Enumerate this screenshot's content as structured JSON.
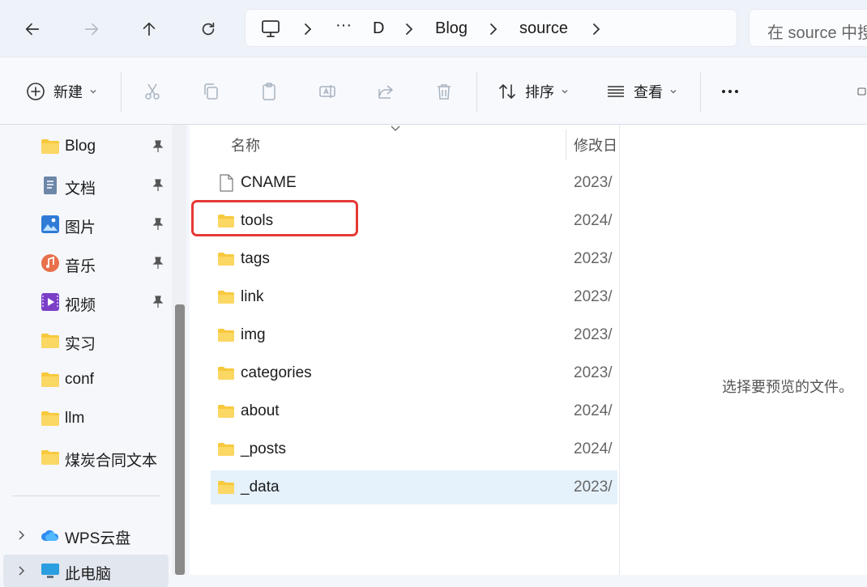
{
  "address_bar": {
    "path": [
      "D",
      "Blog",
      "source"
    ],
    "ellipsis": "···"
  },
  "search": {
    "placeholder": "在 source 中搜"
  },
  "commands": {
    "new": "新建",
    "sort": "排序",
    "view": "查看"
  },
  "nav": {
    "quick_access": [
      {
        "label": "Blog",
        "icon": "folder-icon",
        "pinned": true
      },
      {
        "label": "文档",
        "icon": "documents-icon",
        "pinned": true
      },
      {
        "label": "图片",
        "icon": "pictures-icon",
        "pinned": true
      },
      {
        "label": "音乐",
        "icon": "music-icon",
        "pinned": true
      },
      {
        "label": "视频",
        "icon": "videos-icon",
        "pinned": true
      },
      {
        "label": "实习",
        "icon": "folder-icon",
        "pinned": false
      },
      {
        "label": "conf",
        "icon": "folder-icon",
        "pinned": false
      },
      {
        "label": "llm",
        "icon": "folder-icon",
        "pinned": false
      },
      {
        "label": "煤炭合同文本",
        "icon": "folder-icon",
        "pinned": false
      }
    ],
    "cloud": "WPS云盘",
    "this_pc": "此电脑"
  },
  "file_list": {
    "columns": {
      "name": "名称",
      "modified": "修改日"
    },
    "rows": [
      {
        "name": "CNAME",
        "type": "file",
        "date": "2023/"
      },
      {
        "name": "tools",
        "type": "folder",
        "date": "2024/"
      },
      {
        "name": "tags",
        "type": "folder",
        "date": "2023/"
      },
      {
        "name": "link",
        "type": "folder",
        "date": "2023/"
      },
      {
        "name": "img",
        "type": "folder",
        "date": "2023/"
      },
      {
        "name": "categories",
        "type": "folder",
        "date": "2023/"
      },
      {
        "name": "about",
        "type": "folder",
        "date": "2024/"
      },
      {
        "name": "_posts",
        "type": "folder",
        "date": "2024/"
      },
      {
        "name": "_data",
        "type": "folder",
        "date": "2023/"
      }
    ],
    "selected": "_data",
    "highlighted": "tools"
  },
  "preview": {
    "message": "选择要预览的文件。"
  },
  "colors": {
    "folder": "#f8c93e",
    "highlight_box": "#e53935",
    "selected_row": "#e5f1fb"
  }
}
